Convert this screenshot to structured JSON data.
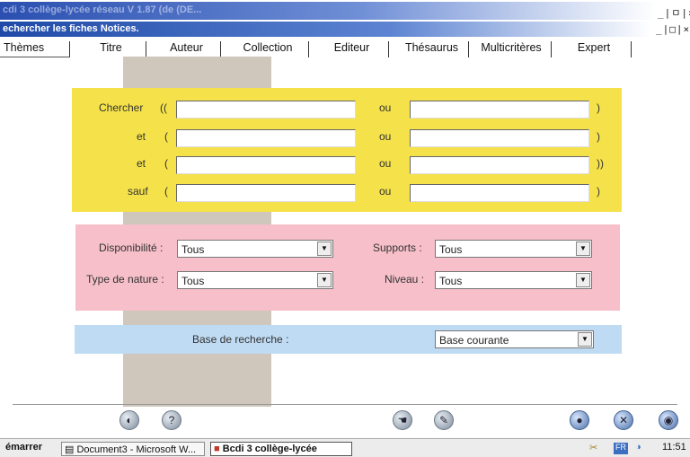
{
  "window": {
    "title": "cdi 3 collège-lycée réseau V 1.87 (de (DE...",
    "subtitle": "echercher les fiches Notices.",
    "controls_top": "_|ㅁ|×",
    "controls_sub": "_|□|×"
  },
  "tabs": [
    "Thèmes",
    "Titre",
    "Auteur",
    "Collection",
    "Editeur",
    "Thésaurus",
    "Multicritères",
    "Expert"
  ],
  "search": {
    "rows": [
      {
        "label": "Chercher",
        "open": "((",
        "or": "ou",
        "close": ")"
      },
      {
        "label": "et",
        "open": "(",
        "or": "ou",
        "close": ")"
      },
      {
        "label": "et",
        "open": "(",
        "or": "ou",
        "close": "))"
      },
      {
        "label": "sauf",
        "open": "(",
        "or": "ou",
        "close": ")"
      }
    ]
  },
  "filters": {
    "disponibilite_label": "Disponibilité :",
    "disponibilite_value": "Tous",
    "supports_label": "Supports :",
    "supports_value": "Tous",
    "type_label": "Type de nature :",
    "type_value": "Tous",
    "niveau_label": "Niveau :",
    "niveau_value": "Tous"
  },
  "base": {
    "label": "Base de recherche :",
    "value": "Base courante"
  },
  "taskbar": {
    "start": "émarrer",
    "item1": "Document3 - Microsoft W...",
    "item2": "Bcdi 3 collège-lycée",
    "tray": "FR",
    "clock": "11:51"
  },
  "icons": [
    "back-icon",
    "help-icon",
    "hand-icon",
    "clear-icon",
    "validate-icon",
    "close-icon",
    "globe-icon"
  ],
  "colors": {
    "search_panel": "#f5e24a",
    "filter_panel": "#f6bfc9",
    "base_panel": "#bfdbf3",
    "titlebar": "#2a4fb0"
  }
}
